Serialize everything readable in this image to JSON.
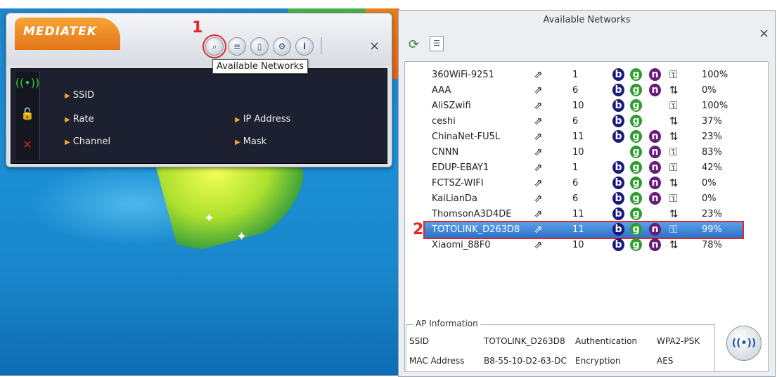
{
  "mediatek": {
    "logo": "MEDIATEK",
    "tooltip": "Available Networks",
    "step1": "1",
    "toolbar": {
      "available_networks": "⌕",
      "list": "≡",
      "doc": "▯",
      "settings": "⚙",
      "info": "i",
      "close": "×"
    },
    "labels": {
      "ssid": "SSID",
      "rate": "Rate",
      "channel": "Channel",
      "ip": "IP Address",
      "mask": "Mask"
    },
    "icons": [
      "wifi-signal-icon",
      "unlocked-icon",
      "no-signal-icon"
    ]
  },
  "available_networks": {
    "title": "Available Networks",
    "close": "×",
    "step2": "2",
    "networks": [
      {
        "ssid": "360WiFi-9251",
        "channel": "1",
        "b": true,
        "g": true,
        "n": true,
        "security": "key",
        "signal": "100%"
      },
      {
        "ssid": "AAA",
        "channel": "6",
        "b": true,
        "g": true,
        "n": true,
        "security": "arrows",
        "signal": "0%"
      },
      {
        "ssid": "AliSZwifi",
        "channel": "10",
        "b": true,
        "g": true,
        "n": false,
        "security": "key",
        "signal": "100%"
      },
      {
        "ssid": "ceshi",
        "channel": "6",
        "b": true,
        "g": true,
        "n": false,
        "security": "arrows",
        "signal": "37%"
      },
      {
        "ssid": "ChinaNet-FU5L",
        "channel": "11",
        "b": true,
        "g": true,
        "n": true,
        "security": "arrows",
        "signal": "23%"
      },
      {
        "ssid": "CNNN",
        "channel": "10",
        "b": false,
        "g": true,
        "n": true,
        "security": "key",
        "signal": "83%"
      },
      {
        "ssid": "EDUP-EBAY1",
        "channel": "1",
        "b": true,
        "g": true,
        "n": true,
        "security": "key",
        "signal": "42%"
      },
      {
        "ssid": "FCTSZ-WIFI",
        "channel": "6",
        "b": true,
        "g": true,
        "n": true,
        "security": "arrows",
        "signal": "0%"
      },
      {
        "ssid": "KaiLianDa",
        "channel": "6",
        "b": true,
        "g": true,
        "n": true,
        "security": "key",
        "signal": "0%"
      },
      {
        "ssid": "ThomsonA3D4DE",
        "channel": "11",
        "b": true,
        "g": true,
        "n": false,
        "security": "arrows",
        "signal": "23%"
      },
      {
        "ssid": "TOTOLINK_D263D8",
        "channel": "11",
        "b": true,
        "g": true,
        "n": true,
        "security": "key",
        "signal": "99%",
        "selected": true
      },
      {
        "ssid": "Xiaomi_88F0",
        "channel": "10",
        "b": true,
        "g": true,
        "n": true,
        "security": "arrows",
        "signal": "78%"
      }
    ],
    "ap_info": {
      "legend": "AP Information",
      "ssid_label": "SSID",
      "ssid_value": "TOTOLINK_D263D8",
      "auth_label": "Authentication",
      "auth_value": "WPA2-PSK",
      "mac_label": "MAC Address",
      "mac_value": "B8-55-10-D2-63-DC",
      "enc_label": "Encryption",
      "enc_value": "AES"
    }
  }
}
